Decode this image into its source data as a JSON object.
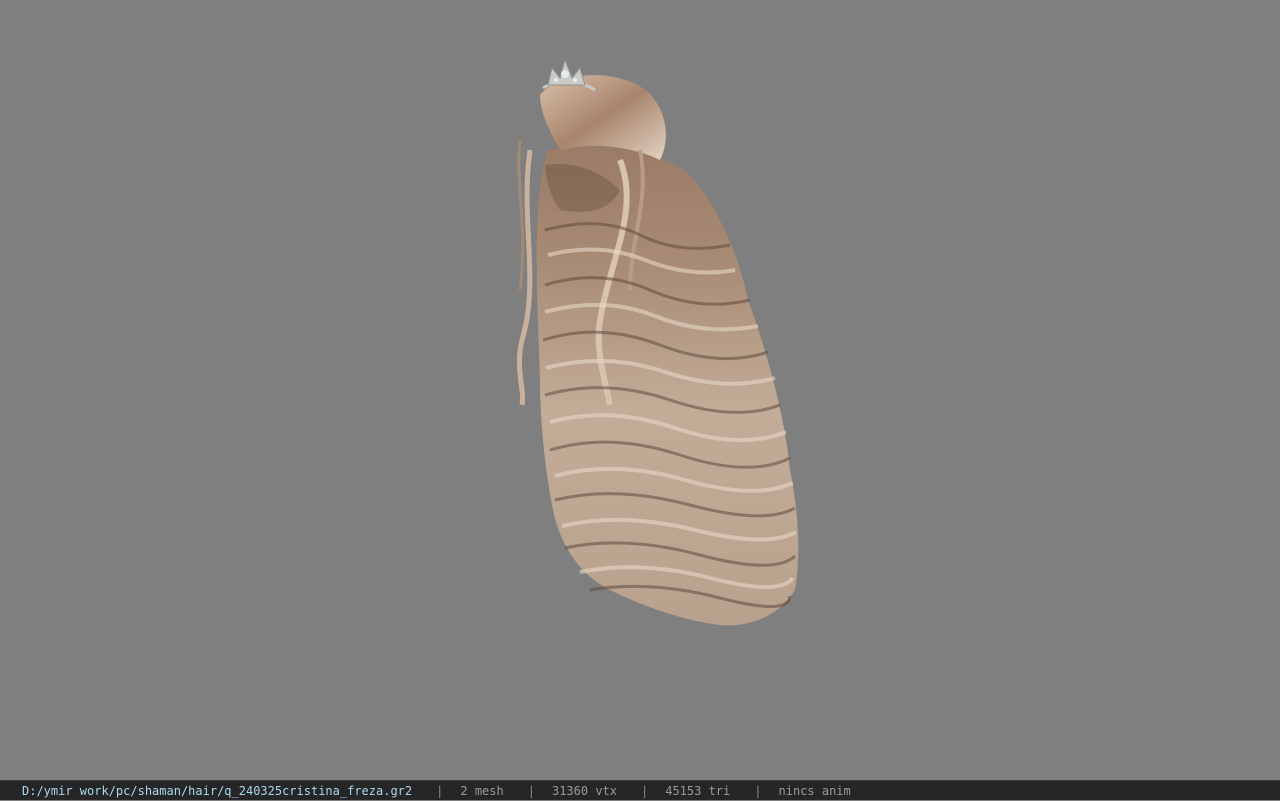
{
  "viewport": {
    "background_color": "#7f7f7f",
    "model": {
      "subject": "hair-model-render",
      "accessory": "tiara-icon"
    }
  },
  "status": {
    "path": "D:/ymir work/pc/shaman/hair/q_240325cristina_freza.gr2",
    "mesh": "2 mesh",
    "vertices": "31360 vtx",
    "triangles": "45153 tri",
    "anim": "nincs anim",
    "separator": "|"
  },
  "colors": {
    "status_background": "#262626",
    "path_text": "#a8d8ee",
    "status_text": "#9a9a9a",
    "hair_light": "#d8c3ae",
    "hair_dark": "#6b5546"
  }
}
